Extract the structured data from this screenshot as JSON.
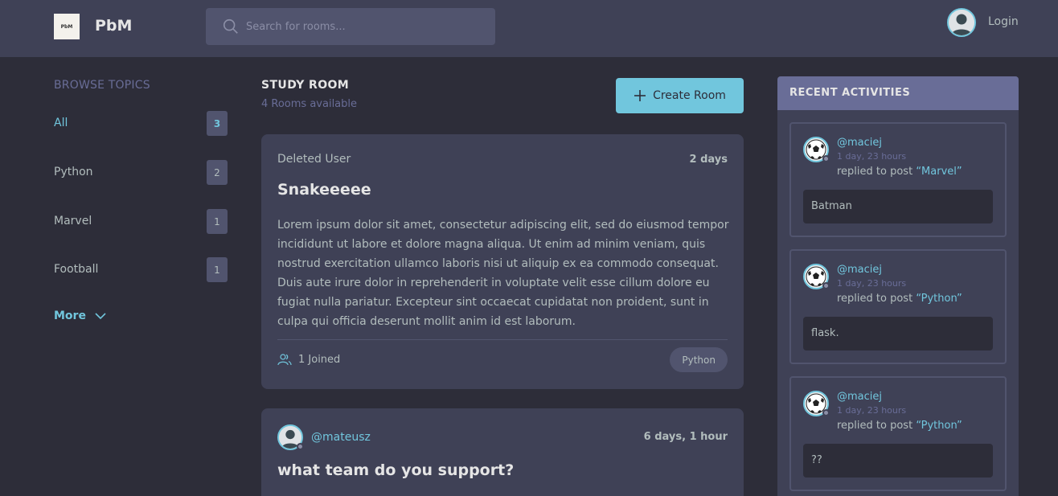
{
  "header": {
    "logo_text": "PbM",
    "brand": "PbM",
    "search_placeholder": "Search for rooms...",
    "login_label": "Login"
  },
  "topics": {
    "heading": "BROWSE TOPICS",
    "items": [
      {
        "label": "All",
        "count": "3"
      },
      {
        "label": "Python",
        "count": "2"
      },
      {
        "label": "Marvel",
        "count": "1"
      },
      {
        "label": "Football",
        "count": "1"
      }
    ],
    "more_label": "More"
  },
  "main": {
    "title": "STUDY ROOM",
    "rooms_available": "4 Rooms available",
    "create_label": "Create Room",
    "rooms": [
      {
        "host": "Deleted User",
        "time": "2 days",
        "title": "Snakeeeee",
        "description": "Lorem ipsum dolor sit amet, consectetur adipiscing elit, sed do eiusmod tempor incididunt ut labore et dolore magna aliqua. Ut enim ad minim veniam, quis nostrud exercitation ullamco laboris nisi ut aliquip ex ea commodo consequat. Duis aute irure dolor in reprehenderit in voluptate velit esse cillum dolore eu fugiat nulla pariatur. Excepteur sint occaecat cupidatat non proident, sunt in culpa qui officia deserunt mollit anim id est laborum.",
        "joined": "1 Joined",
        "topic": "Python"
      },
      {
        "host": "@mateusz",
        "time": "6 days, 1 hour",
        "title": "what team do you support?"
      }
    ]
  },
  "activities": {
    "heading": "RECENT ACTIVITIES",
    "items": [
      {
        "user": "@maciej",
        "time": "1 day, 23 hours",
        "action": "replied to post ",
        "post": "“Marvel”",
        "body": "Batman"
      },
      {
        "user": "@maciej",
        "time": "1 day, 23 hours",
        "action": "replied to post ",
        "post": "“Python”",
        "body": "flask."
      },
      {
        "user": "@maciej",
        "time": "1 day, 23 hours",
        "action": "replied to post ",
        "post": "“Python”",
        "body": "??"
      }
    ]
  },
  "colors": {
    "accent": "#71c6dd",
    "background": "#2d2d39",
    "card": "#3f4156",
    "muted": "#696d97"
  },
  "icons": [
    "search-icon",
    "user-avatar-icon",
    "chevron-down-icon",
    "plus-icon",
    "users-icon",
    "soccer-ball-icon"
  ]
}
